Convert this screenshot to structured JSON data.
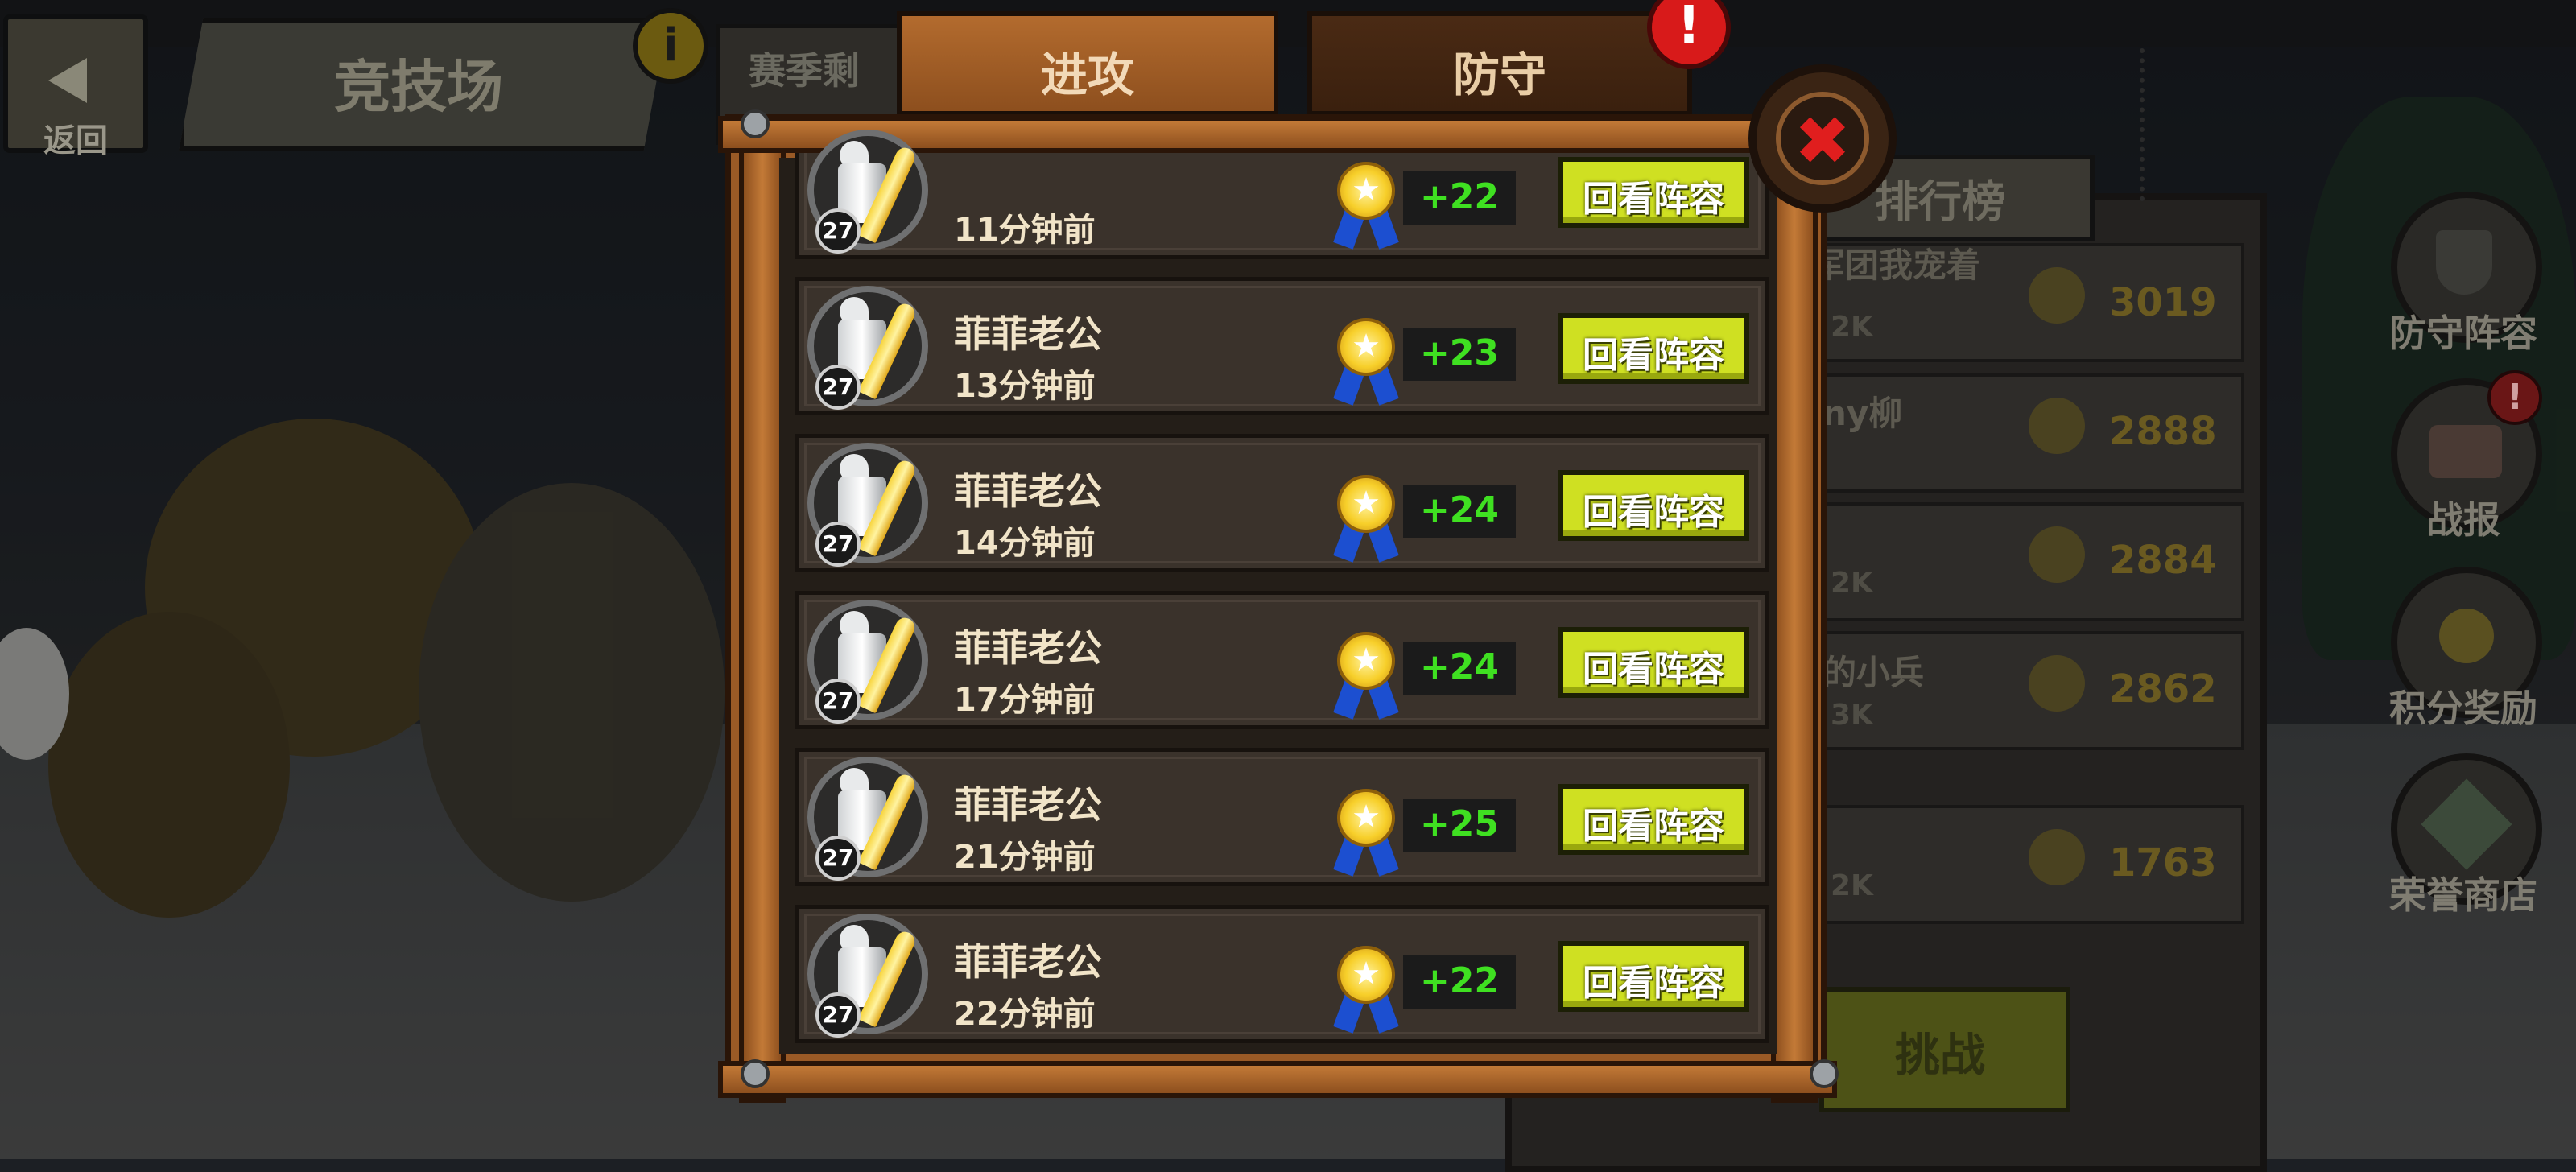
{
  "header": {
    "back_label": "返回",
    "title": "竞技场",
    "season_label": "赛季剩"
  },
  "tabs": [
    {
      "label": "进攻",
      "active": true
    },
    {
      "label": "防守",
      "active": false,
      "alert": "!"
    }
  ],
  "close_symbol": "✖",
  "battle_log": [
    {
      "name": "",
      "time": "11分钟前",
      "level": "27",
      "score": "+22",
      "replay_label": "回看阵容"
    },
    {
      "name": "菲菲老公",
      "time": "13分钟前",
      "level": "27",
      "score": "+23",
      "replay_label": "回看阵容"
    },
    {
      "name": "菲菲老公",
      "time": "14分钟前",
      "level": "27",
      "score": "+24",
      "replay_label": "回看阵容"
    },
    {
      "name": "菲菲老公",
      "time": "17分钟前",
      "level": "27",
      "score": "+24",
      "replay_label": "回看阵容"
    },
    {
      "name": "菲菲老公",
      "time": "21分钟前",
      "level": "27",
      "score": "+25",
      "replay_label": "回看阵容"
    },
    {
      "name": "菲菲老公",
      "time": "22分钟前",
      "level": "27",
      "score": "+22",
      "replay_label": "回看阵容"
    }
  ],
  "ranking": {
    "title": "排行榜",
    "rows": [
      {
        "name": "军团我宠着",
        "power": "2K",
        "score": "3019"
      },
      {
        "name": "ny柳",
        "power": "",
        "score": "2888"
      },
      {
        "name": "",
        "power": "2K",
        "score": "2884"
      },
      {
        "name": "的小兵",
        "power": "3K",
        "score": "2862"
      },
      {
        "name": "",
        "power": "2K",
        "score": "1763"
      }
    ],
    "challenge_label": "挑战"
  },
  "side_menu": [
    {
      "label": "防守阵容",
      "icon": "shield-icon"
    },
    {
      "label": "战报",
      "icon": "scroll-icon",
      "alert": "!"
    },
    {
      "label": "积分奖励",
      "icon": "medal-icon"
    },
    {
      "label": "荣誉商店",
      "icon": "gem-icon"
    }
  ],
  "colors": {
    "active_tab": "#b36b2e",
    "score_green": "#3fe021",
    "replay_button": "#cfe022",
    "close_red": "#e01e1e"
  }
}
